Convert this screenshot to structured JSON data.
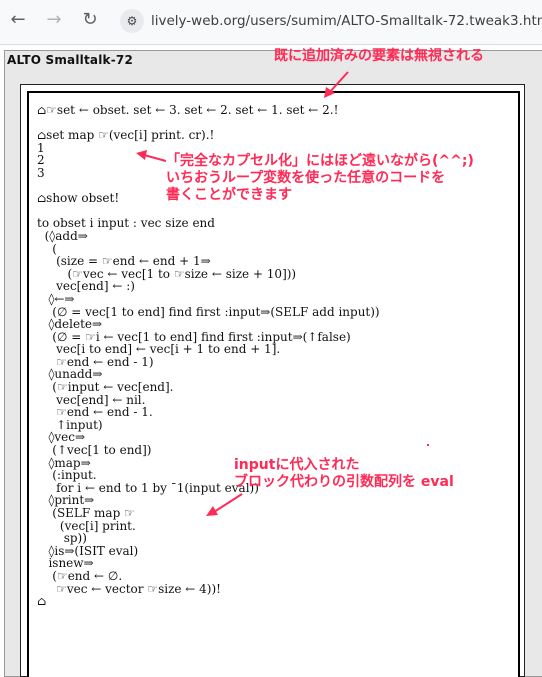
{
  "browser": {
    "url": "lively-web.org/users/sumim/ALTO-Smalltalk-72.tweak3.html",
    "back_icon": "arrow-left-icon",
    "forward_icon": "arrow-right-icon",
    "reload_icon": "reload-icon",
    "site_info_icon": "tune-icon"
  },
  "window": {
    "title": "ALTO Smalltalk-72"
  },
  "code_lines": [
    "⌂☞set ← obset. set ← 3. set ← 2. set ← 1. set ← 2.!",
    "",
    "⌂set map ☞(vec[i] print. cr).!",
    "1",
    "2",
    "3",
    "",
    "⌂show obset!",
    "",
    "to obset i input : vec size end",
    "  (◊add⇒",
    "    (",
    "     (size = ☞end ← end + 1⇒",
    "        (☞vec ← vec[1 to ☞size ← size + 10]))",
    "     vec[end] ← :)",
    "   ◊←⇒",
    "    (∅ = vec[1 to end] find first :input⇒(SELF add input))",
    "   ◊delete⇒",
    "    (∅ = ☞i ← vec[1 to end] find first :input⇒(↑false)",
    "     vec[i to end] ← vec[i + 1 to end + 1].",
    "     ☞end ← end - 1)",
    "   ◊unadd⇒",
    "    (☞input ← vec[end].",
    "     vec[end] ← nil.",
    "     ☞end ← end - 1.",
    "     ↑input)",
    "   ◊vec⇒",
    "    (↑vec[1 to end])",
    "   ◊map⇒",
    "    (:input.",
    "     for i ← end to 1 by ¯1(input eval))",
    "   ◊print⇒",
    "    (SELF map ☞",
    "      (vec[i] print.",
    "       sp))",
    "   ◊is⇒(ISIT eval)",
    "   isnew⇒",
    "    (☞end ← ∅.",
    "     ☞vec ← vector ☞size ← 4))!",
    "⌂"
  ],
  "annotations": {
    "top": "既に追加済みの要素は無視される",
    "middle_1": "「完全なカプセル化」にはほど遠いながら(^^;)",
    "middle_2": "いちおうループ変数を使った任意のコードを",
    "middle_3": "書くことができます",
    "bottom_1": "inputに代入された",
    "bottom_2": "ブロック代わりの引数配列を eval"
  },
  "colors": {
    "annotation": "#ff2a55",
    "window_bg": "#e8e8e8",
    "code_text": "#111111"
  }
}
